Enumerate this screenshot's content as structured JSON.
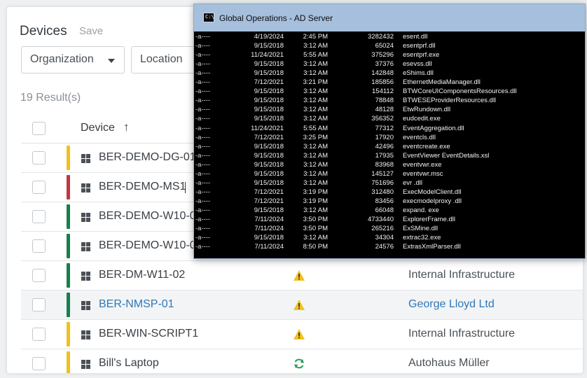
{
  "page": {
    "title": "Devices",
    "save_label": "Save",
    "filters": {
      "organization": "Organization",
      "location": "Location"
    },
    "results": "19 Result(s)",
    "columns": {
      "device": "Device",
      "sort_arrow": "↑"
    }
  },
  "colors": {
    "yellow": "#f2c01e",
    "red": "#c4373f",
    "green": "#17804d",
    "link": "#2f78b7"
  },
  "devices": [
    {
      "name": "BER-DEMO-DG-01",
      "bar": "yellow",
      "status": "",
      "org": ""
    },
    {
      "name": "BER-DEMO-MS1",
      "bar": "red",
      "status": "",
      "org": ""
    },
    {
      "name": "BER-DEMO-W10-0",
      "bar": "green",
      "status": "",
      "org": ""
    },
    {
      "name": "BER-DEMO-W10-0",
      "bar": "green",
      "status": "",
      "org": ""
    },
    {
      "name": "BER-DM-W11-02",
      "bar": "green",
      "status": "warning-icon",
      "org": "Internal Infrastructure"
    },
    {
      "name": "BER-NMSP-01",
      "bar": "green",
      "status": "warning-icon",
      "org": "George Lloyd Ltd"
    },
    {
      "name": "BER-WIN-SCRIPT1",
      "bar": "yellow",
      "status": "warning-icon",
      "org": "Internal Infrastructure"
    },
    {
      "name": "Bill's Laptop",
      "bar": "yellow",
      "status": "sync-icon",
      "org": "Autohaus Müller"
    }
  ],
  "terminal": {
    "title": "Global Operations - AD Server",
    "icon_text": "C:\\",
    "lines": [
      {
        "attr": "-a----",
        "date": "4/19/2024",
        "time": "2:45 PM",
        "size": "3282432",
        "name": "esent.dll"
      },
      {
        "attr": "-a----",
        "date": "9/15/2018",
        "time": "3:12 AM",
        "size": "65024",
        "name": "esentprf.dll"
      },
      {
        "attr": "-a----",
        "date": "11/24/2021",
        "time": "5:55 AM",
        "size": "375296",
        "name": "esentprf.exe"
      },
      {
        "attr": "-a----",
        "date": "9/15/2018",
        "time": "3:12 AM",
        "size": "37376",
        "name": "esevss.dll"
      },
      {
        "attr": "-a----",
        "date": "9/15/2018",
        "time": "3:12 AM",
        "size": "142848",
        "name": "eShims.dll"
      },
      {
        "attr": "-a----",
        "date": "7/12/2021",
        "time": "3:21 PM",
        "size": "185856",
        "name": "EthernetMediaManager.dll"
      },
      {
        "attr": "-a----",
        "date": "9/15/2018",
        "time": "3:12 AM",
        "size": "154112",
        "name": "BTWCoreUIComponentsResources.dll"
      },
      {
        "attr": "-a----",
        "date": "9/15/2018",
        "time": "3:12 AM",
        "size": "78848",
        "name": "BTWESEProviderResources.dll"
      },
      {
        "attr": "-a----",
        "date": "9/15/2018",
        "time": "3:12 AM",
        "size": "48128",
        "name": "EtwRundown.dll"
      },
      {
        "attr": "-a----",
        "date": "9/15/2018",
        "time": "3:12 AM",
        "size": "356352",
        "name": "eudcedit.exe"
      },
      {
        "attr": "-a----",
        "date": "11/24/2021",
        "time": "5:55 AM",
        "size": "77312",
        "name": "EventAggregation.dll"
      },
      {
        "attr": "-a----",
        "date": "7/12/2021",
        "time": "3:25 PM",
        "size": "17920",
        "name": "eventcls.dll"
      },
      {
        "attr": "-a----",
        "date": "9/15/2018",
        "time": "3:12 AM",
        "size": "42496",
        "name": "eventcreate.exe"
      },
      {
        "attr": "-a----",
        "date": "9/15/2018",
        "time": "3:12 AM",
        "size": "17935",
        "name": "EventViewer EventDetails.xsl"
      },
      {
        "attr": "-a----",
        "date": "9/15/2018",
        "time": "3:12 AM",
        "size": "83968",
        "name": "eventvwr.exe"
      },
      {
        "attr": "-a----",
        "date": "9/15/2018",
        "time": "3:12 AM",
        "size": "145127",
        "name": "eventvwr.msc"
      },
      {
        "attr": "-a----",
        "date": "9/15/2018",
        "time": "3:12 AM",
        "size": "751696",
        "name": "evr .dll"
      },
      {
        "attr": "-a----",
        "date": "7/12/2021",
        "time": "3:19 PM",
        "size": "312480",
        "name": "ExecModelClient.dll"
      },
      {
        "attr": "-a----",
        "date": "7/12/2021",
        "time": "3:19 PM",
        "size": "83456",
        "name": "execmodelproxy .dll"
      },
      {
        "attr": "-a----",
        "date": "9/15/2018",
        "time": "3:12 AM",
        "size": "66048",
        "name": "expand. exe"
      },
      {
        "attr": "-a----",
        "date": "7/11/2024",
        "time": "3:50 PM",
        "size": "4733440",
        "name": "ExplorerFrame.dll"
      },
      {
        "attr": "-a----",
        "date": "7/11/2024",
        "time": "3:50 PM",
        "size": "265216",
        "name": "ExSMine.dll"
      },
      {
        "attr": "-a----",
        "date": "9/15/2018",
        "time": "3:12 AM",
        "size": "34304",
        "name": "extrac32.exe"
      },
      {
        "attr": "-a----",
        "date": "7/11/2024",
        "time": "8:50 PM",
        "size": "24576",
        "name": "ExtrasXmlParser.dll"
      }
    ]
  }
}
